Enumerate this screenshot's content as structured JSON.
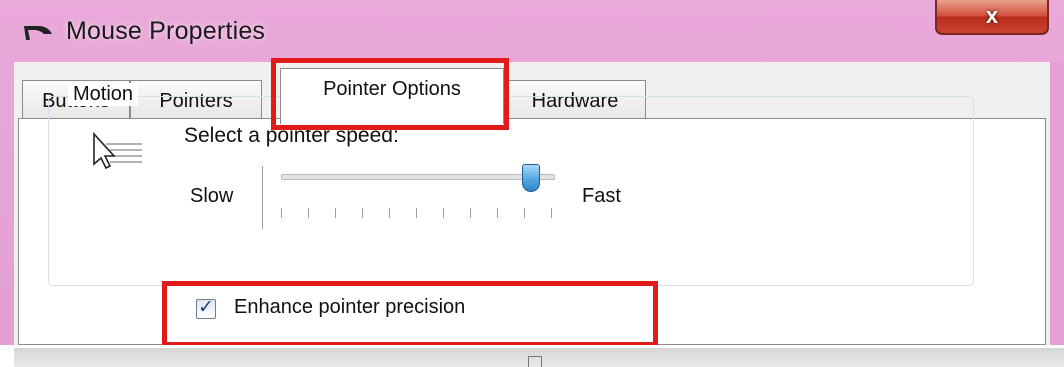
{
  "window": {
    "title": "Mouse Properties",
    "close_glyph": "x",
    "icon": "mouse-icon"
  },
  "tabs": [
    {
      "label": "Buttons",
      "active": false
    },
    {
      "label": "Pointers",
      "active": false
    },
    {
      "label": "Pointer Options",
      "active": true
    },
    {
      "label": "Hardware",
      "active": false
    }
  ],
  "motion": {
    "group_label": "Motion",
    "icon": "pointer-speed-icon",
    "speed_label": "Select a pointer speed:",
    "slow_label": "Slow",
    "fast_label": "Fast",
    "speed_fraction": 0.92,
    "enhance_precision": {
      "label": "Enhance pointer precision",
      "checked": true
    }
  },
  "annotations": {
    "highlight_color": "#e11a1a"
  },
  "colors": {
    "title_bar": "#e6a3d6",
    "close_button": "#c8452f",
    "slider_thumb": "#52a8e2"
  }
}
